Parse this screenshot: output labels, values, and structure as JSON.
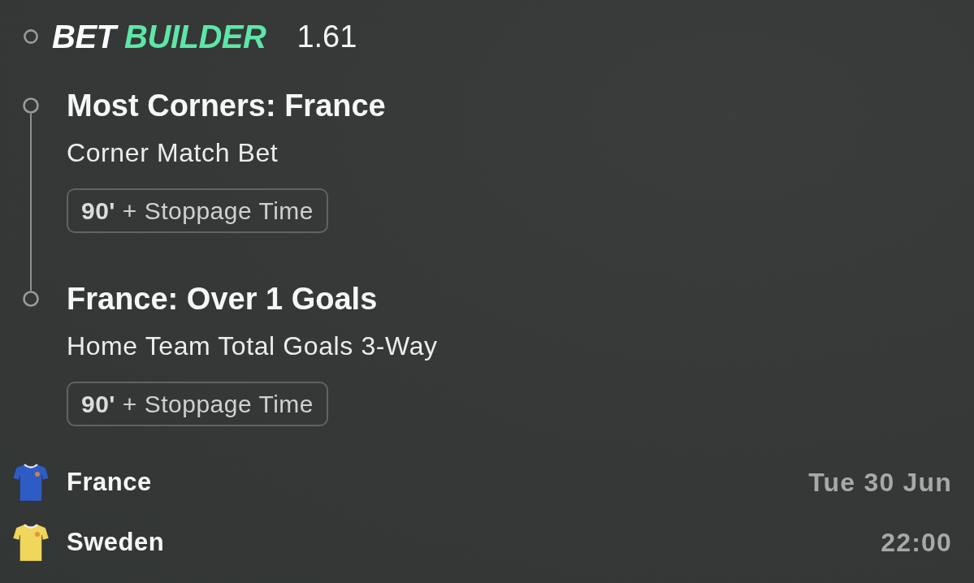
{
  "header": {
    "brand": [
      {
        "text": "BET",
        "kind": "plain"
      },
      {
        "text": "BUILDER",
        "kind": "accent"
      }
    ],
    "odds": "1.61"
  },
  "legs": [
    {
      "selection": "Most Corners: France",
      "market": "Corner Match Bet",
      "period": "**90'** + Stoppage Time"
    },
    {
      "selection": "France: Over 1 Goals",
      "market": "Home Team Total Goals 3-Way",
      "period": "**90'** + Stoppage Time"
    }
  ],
  "match": {
    "teams": [
      {
        "name": "France",
        "color": "#2f5cc4"
      },
      {
        "name": "Sweden",
        "color": "#f0d65c"
      }
    ],
    "date": "Tue 30 Jun",
    "time": "22:00"
  }
}
